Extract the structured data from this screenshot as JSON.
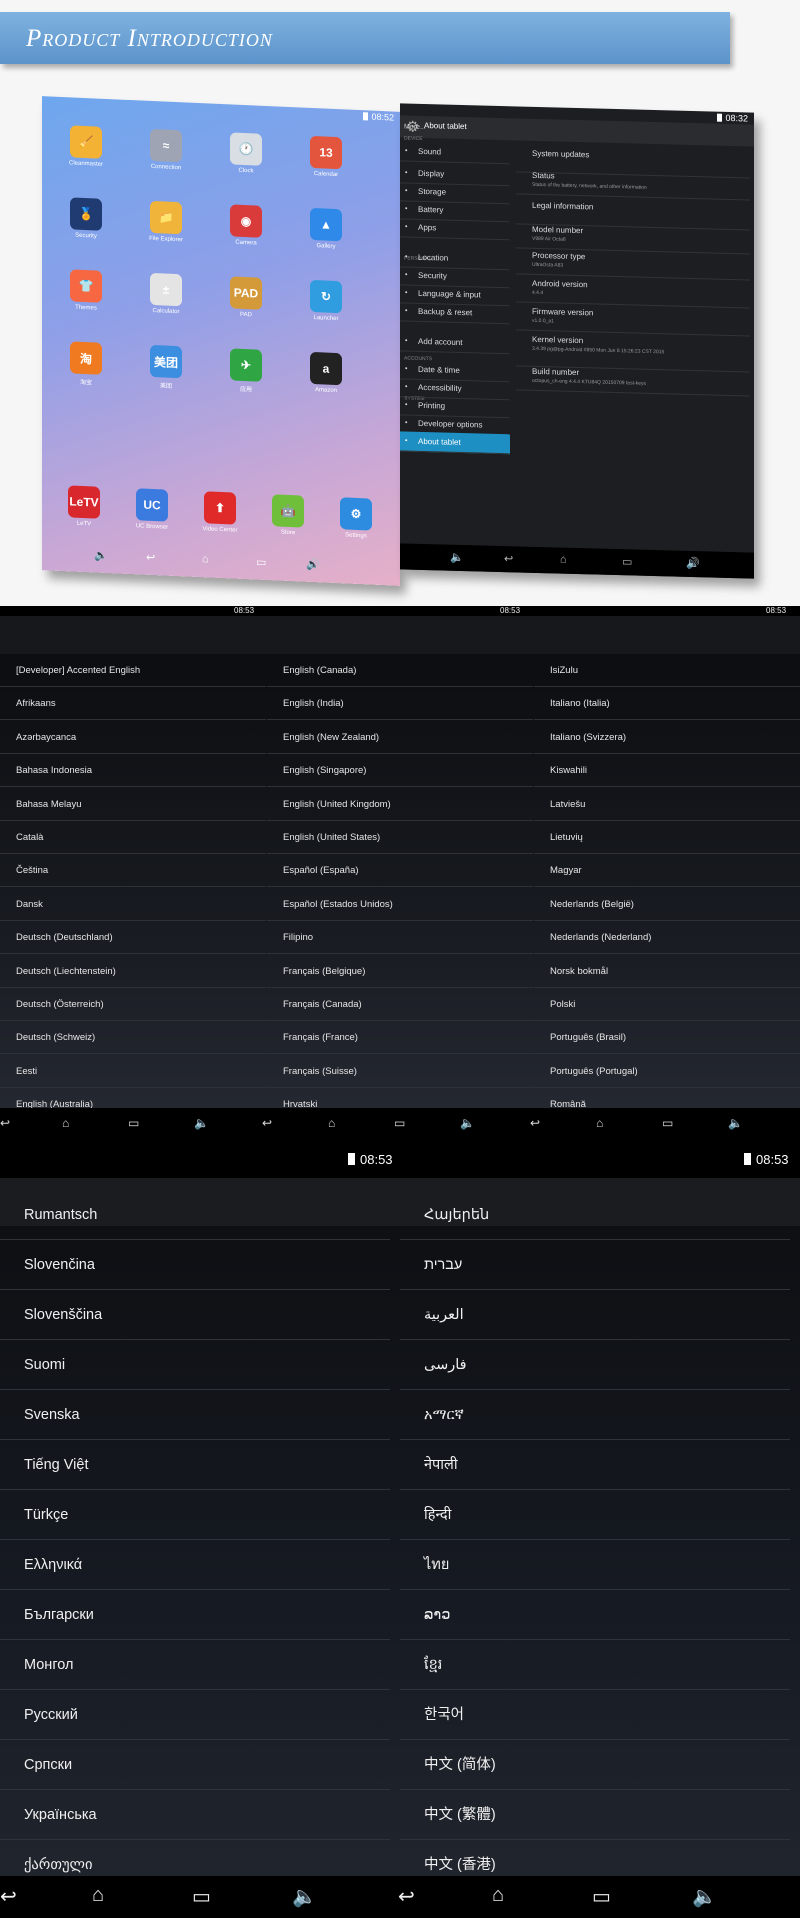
{
  "banner": {
    "title": "Product Introduction"
  },
  "home": {
    "time": "08:52",
    "apps": [
      "Cleanmaster",
      "Connection",
      "Clock",
      "Calendar",
      "Security",
      "File Explorer",
      "Camera",
      "Gallery",
      "Themes",
      "Calculator",
      "PAD",
      "Launcher",
      "淘宝",
      "美团",
      "应用",
      "Amazon"
    ],
    "dock": [
      "LeTV",
      "UC Browser",
      "Video Center",
      "Store",
      "Settings"
    ]
  },
  "settings": {
    "time": "08:32",
    "header": "About tablet",
    "more": "More...",
    "cat_device": "DEVICE",
    "cat_personal": "PERSONAL",
    "cat_accounts": "ACCOUNTS",
    "cat_system": "SYSTEM",
    "left": [
      "Sound",
      "Display",
      "Storage",
      "Battery",
      "Apps",
      "Location",
      "Security",
      "Language & input",
      "Backup & reset",
      "Add account",
      "Date & time",
      "Accessibility",
      "Printing",
      "Developer options",
      "About tablet"
    ],
    "right": [
      {
        "t": "System updates",
        "s": ""
      },
      {
        "t": "Status",
        "s": "Status of the battery, network, and other information"
      },
      {
        "t": "Legal information",
        "s": ""
      },
      {
        "t": "Model number",
        "s": "V989 Air Octa8"
      },
      {
        "t": "Processor type",
        "s": "UltraOcta A83"
      },
      {
        "t": "Android version",
        "s": "4.4.4"
      },
      {
        "t": "Firmware version",
        "s": "v1.0.0_a1"
      },
      {
        "t": "Kernel version",
        "s": "3.4.39 pg@pg-Android #850 Mon Jun 8 15:26:23 CST 2015"
      },
      {
        "t": "Build number",
        "s": "octopus_ch-eng 4.4.4 KTU84Q 20150709 test-keys"
      }
    ]
  },
  "lang_small": {
    "times": [
      "08:53",
      "08:53",
      "08:53"
    ],
    "col1": [
      "[Developer] Accented English",
      "Afrikaans",
      "Azərbaycanca",
      "Bahasa Indonesia",
      "Bahasa Melayu",
      "Català",
      "Čeština",
      "Dansk",
      "Deutsch (Deutschland)",
      "Deutsch (Liechtenstein)",
      "Deutsch (Österreich)",
      "Deutsch (Schweiz)",
      "Eesti",
      "English (Australia)"
    ],
    "col2": [
      "English (Canada)",
      "English (India)",
      "English (New Zealand)",
      "English (Singapore)",
      "English (United Kingdom)",
      "English (United States)",
      "Español (España)",
      "Español (Estados Unidos)",
      "Filipino",
      "Français (Belgique)",
      "Français (Canada)",
      "Français (France)",
      "Français (Suisse)",
      "Hrvatski"
    ],
    "col3": [
      "IsiZulu",
      "Italiano (Italia)",
      "Italiano (Svizzera)",
      "Kiswahili",
      "Latviešu",
      "Lietuvių",
      "Magyar",
      "Nederlands (België)",
      "Nederlands (Nederland)",
      "Norsk bokmål",
      "Polski",
      "Português (Brasil)",
      "Português (Portugal)",
      "Română"
    ]
  },
  "lang_big": {
    "times": [
      "08:53",
      "08:53"
    ],
    "col1": [
      "Rumantsch",
      "Slovenčina",
      "Slovenščina",
      "Suomi",
      "Svenska",
      "Tiếng Việt",
      "Türkçe",
      "Ελληνικά",
      "Български",
      "Монгол",
      "Русский",
      "Српски",
      "Українська",
      "ქართული"
    ],
    "col2": [
      "Հայերեն",
      "עברית",
      "العربية",
      "فارسی",
      "አማርኛ",
      "नेपाली",
      "हिन्दी",
      "ไทย",
      "ລາວ",
      "ខ្មែរ",
      "한국어",
      "中文 (简体)",
      "中文 (繁體)",
      "中文 (香港)"
    ]
  }
}
